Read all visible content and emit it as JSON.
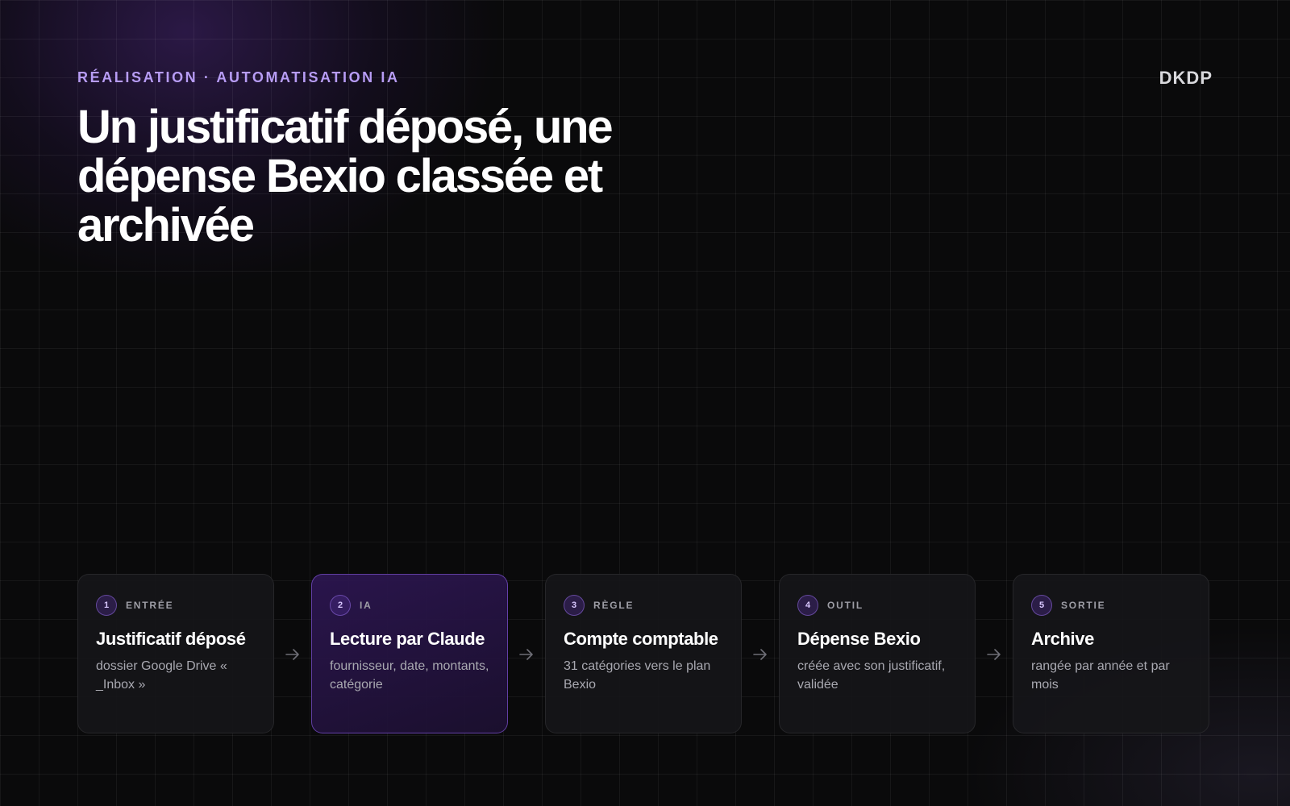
{
  "header": {
    "eyebrow": "RÉALISATION · AUTOMATISATION IA",
    "title": "Un justificatif déposé, une dépense Bexio classée et archivée",
    "brand": "DKDP"
  },
  "colors": {
    "accent": "#b79cf5",
    "background": "#0a0a0b",
    "card_background": "#161619",
    "highlight_border": "#8458dc"
  },
  "steps": [
    {
      "number": "1",
      "tag": "ENTRÉE",
      "title": "Justificatif déposé",
      "description": "dossier Google Drive « _Inbox »"
    },
    {
      "number": "2",
      "tag": "IA",
      "title": "Lecture par Claude",
      "description": "fournisseur, date, montants, catégorie",
      "highlighted": true
    },
    {
      "number": "3",
      "tag": "RÈGLE",
      "title": "Compte comptable",
      "description": "31 catégories vers le plan Bexio"
    },
    {
      "number": "4",
      "tag": "OUTIL",
      "title": "Dépense Bexio",
      "description": "créée avec son justificatif, validée"
    },
    {
      "number": "5",
      "tag": "SORTIE",
      "title": "Archive",
      "description": "rangée par année et par mois"
    }
  ],
  "icons": {
    "connector": "arrow-right-icon"
  }
}
